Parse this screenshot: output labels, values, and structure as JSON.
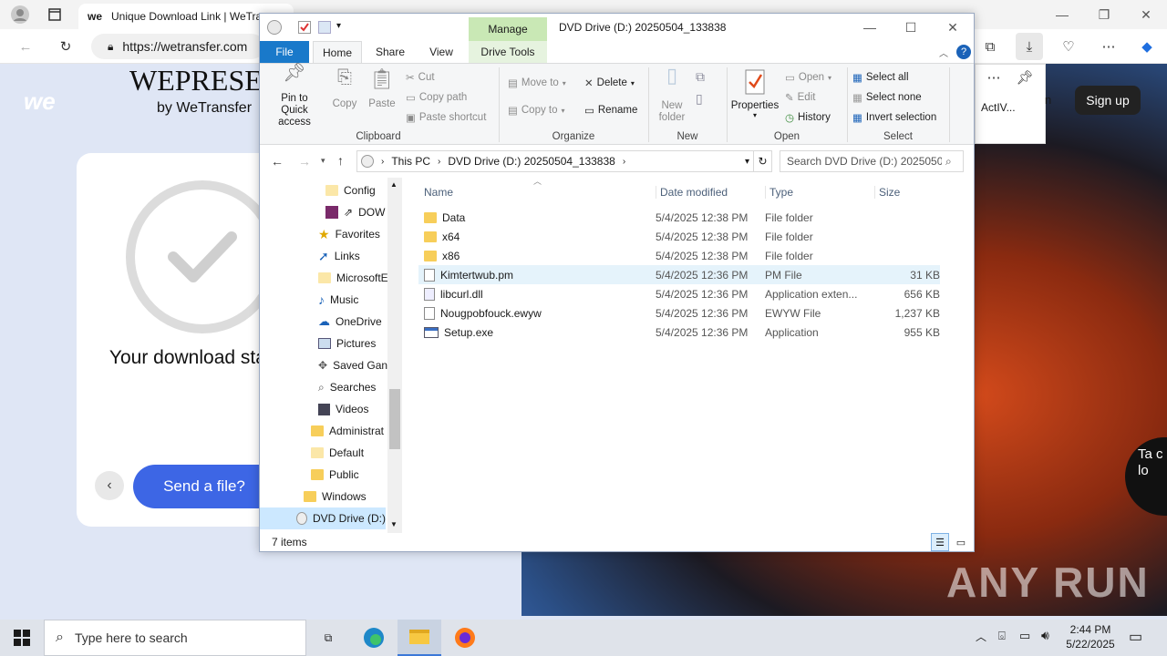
{
  "browser": {
    "tab_title": "Unique Download Link | WeTransfer",
    "url": "https://wetransfer.com",
    "brand_line1": "WEPRESENT",
    "brand_line2": "by WeTransfer",
    "logo_text": "we",
    "download_title": "Your download started",
    "send_button": "Send a file?",
    "signup_button": "Sign up",
    "activity_text": "ActIV...",
    "side_text": "n",
    "side_edge": "Ta c lo"
  },
  "explorer": {
    "context_tab": "Manage",
    "window_title": "DVD Drive (D:) 20250504_133838",
    "tabs": [
      "File",
      "Home",
      "Share",
      "View",
      "Drive Tools"
    ],
    "clipboard": {
      "pin": "Pin to Quick access",
      "copy": "Copy",
      "paste": "Paste",
      "cut": "Cut",
      "copy_path": "Copy path",
      "paste_shortcut": "Paste shortcut",
      "label": "Clipboard"
    },
    "organize": {
      "move_to": "Move to",
      "copy_to": "Copy to",
      "delete": "Delete",
      "rename": "Rename",
      "label": "Organize"
    },
    "new": {
      "new_folder": "New folder",
      "label": "New"
    },
    "open": {
      "properties": "Properties",
      "open": "Open",
      "edit": "Edit",
      "history": "History",
      "label": "Open"
    },
    "select": {
      "select_all": "Select all",
      "select_none": "Select none",
      "invert": "Invert selection",
      "label": "Select"
    },
    "breadcrumb": [
      "This PC",
      "DVD Drive (D:) 20250504_133838"
    ],
    "search_placeholder": "Search DVD Drive (D:) 2025050...",
    "columns": {
      "name": "Name",
      "date": "Date modified",
      "type": "Type",
      "size": "Size"
    },
    "nav_items": [
      {
        "label": "Config"
      },
      {
        "label": "DOW"
      },
      {
        "label": "Favorites"
      },
      {
        "label": "Links"
      },
      {
        "label": "MicrosoftE"
      },
      {
        "label": "Music"
      },
      {
        "label": "OneDrive"
      },
      {
        "label": "Pictures"
      },
      {
        "label": "Saved Gan"
      },
      {
        "label": "Searches"
      },
      {
        "label": "Videos"
      },
      {
        "label": "Administrat"
      },
      {
        "label": "Default"
      },
      {
        "label": "Public"
      },
      {
        "label": "Windows"
      },
      {
        "label": "DVD Drive (D:)"
      }
    ],
    "files": [
      {
        "name": "Data",
        "date": "5/4/2025 12:38 PM",
        "type": "File folder",
        "size": ""
      },
      {
        "name": "x64",
        "date": "5/4/2025 12:38 PM",
        "type": "File folder",
        "size": ""
      },
      {
        "name": "x86",
        "date": "5/4/2025 12:38 PM",
        "type": "File folder",
        "size": ""
      },
      {
        "name": "Kimtertwub.pm",
        "date": "5/4/2025 12:36 PM",
        "type": "PM File",
        "size": "31 KB"
      },
      {
        "name": "libcurl.dll",
        "date": "5/4/2025 12:36 PM",
        "type": "Application exten...",
        "size": "656 KB"
      },
      {
        "name": "Nougpobfouck.ewyw",
        "date": "5/4/2025 12:36 PM",
        "type": "EWYW File",
        "size": "1,237 KB"
      },
      {
        "name": "Setup.exe",
        "date": "5/4/2025 12:36 PM",
        "type": "Application",
        "size": "955 KB"
      }
    ],
    "status": "7 items"
  },
  "taskbar": {
    "search_placeholder": "Type here to search",
    "time": "2:44 PM",
    "date": "5/22/2025"
  },
  "watermark": "ANY RUN"
}
